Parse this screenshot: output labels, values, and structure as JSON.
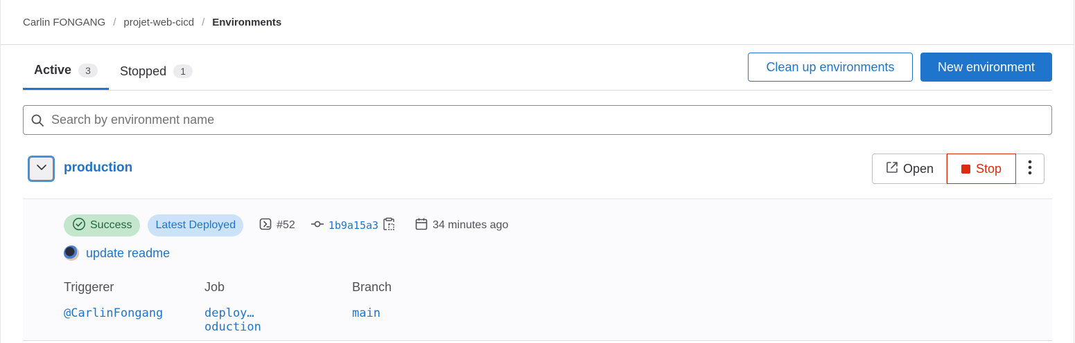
{
  "breadcrumb": {
    "items": [
      "Carlin FONGANG",
      "projet-web-cicd"
    ],
    "current": "Environments",
    "separator": "/"
  },
  "tabs": [
    {
      "label": "Active",
      "count": "3",
      "active": true
    },
    {
      "label": "Stopped",
      "count": "1",
      "active": false
    }
  ],
  "actions": {
    "cleanup_label": "Clean up environments",
    "new_label": "New environment"
  },
  "search": {
    "placeholder": "Search by environment name",
    "value": ""
  },
  "environment": {
    "name": "production",
    "open_label": "Open",
    "stop_label": "Stop",
    "status": "Success",
    "latest_label": "Latest Deployed",
    "deployment_id": "#52",
    "commit_sha": "1b9a15a3",
    "time_ago": "34 minutes ago",
    "commit_title": "update readme",
    "details": {
      "triggerer_label": "Triggerer",
      "triggerer": "@CarlinFongang",
      "job_label": "Job",
      "job": "deploy…oduction",
      "branch_label": "Branch",
      "branch": "main"
    }
  },
  "colors": {
    "accent": "#1f75cb",
    "danger": "#dd2b0e",
    "success_bg": "#c3e6cd",
    "success_text": "#24663b",
    "info_bg": "#cbe2f9"
  }
}
